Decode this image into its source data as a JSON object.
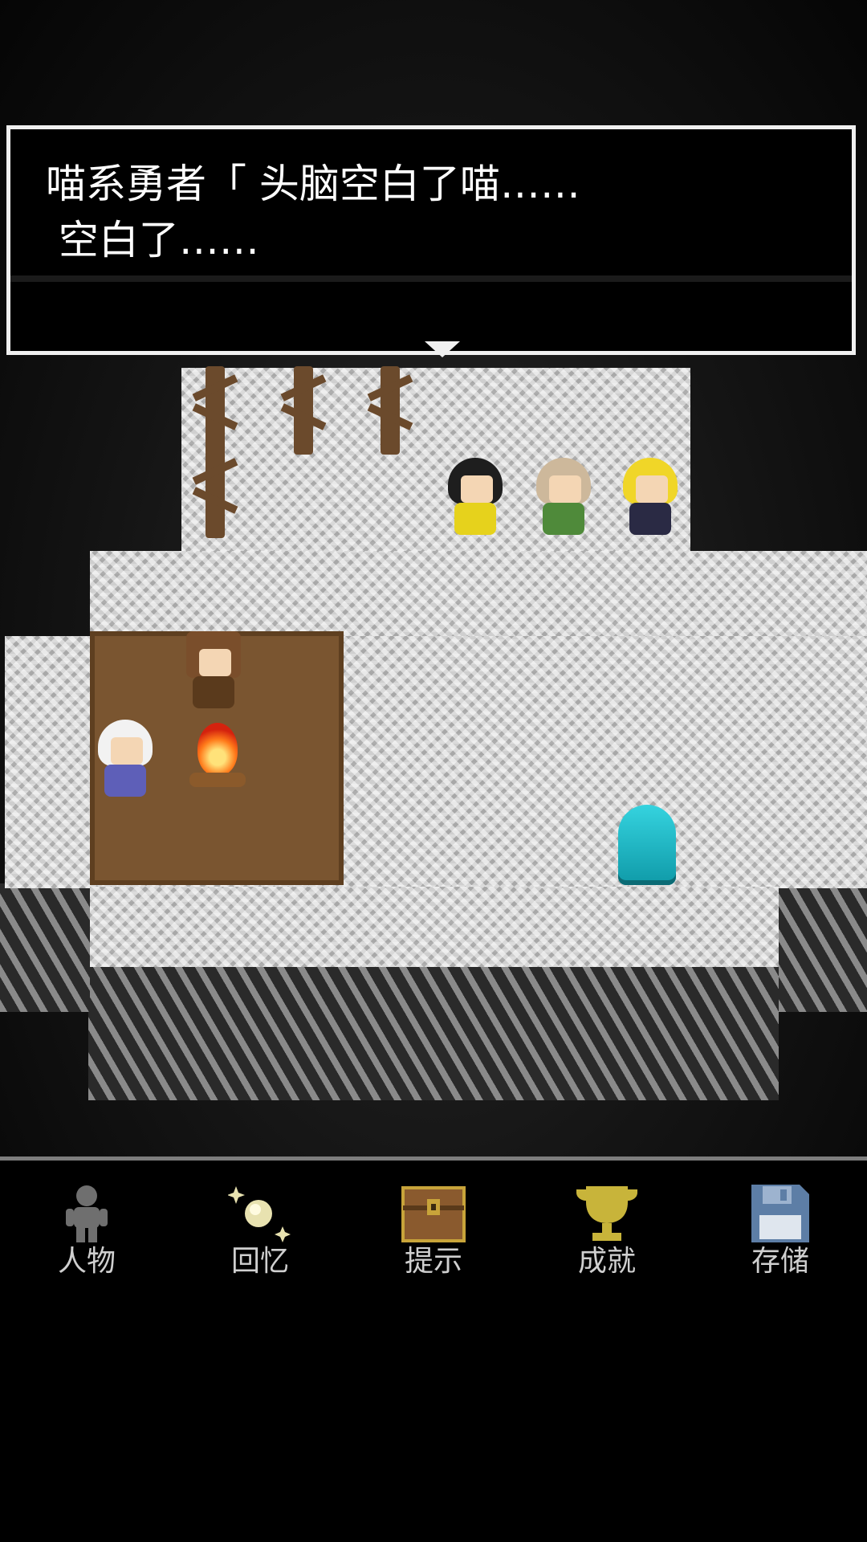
{
  "dialog": {
    "line1": "喵系勇者「 头脑空白了喵……",
    "line2": " 空白了……"
  },
  "menu": {
    "items": [
      {
        "label": "人物",
        "icon": "person-icon"
      },
      {
        "label": "回忆",
        "icon": "sparkle-memory-icon"
      },
      {
        "label": "提示",
        "icon": "treasure-chest-icon"
      },
      {
        "label": "成就",
        "icon": "trophy-icon"
      },
      {
        "label": "存储",
        "icon": "floppy-disk-icon"
      }
    ]
  },
  "colors": {
    "dialog_border": "#f0f0f0",
    "menu_text": "#cfcfcf",
    "menu_border": "#7d7d7d",
    "trophy": "#c8b43a",
    "chest": "#8a5a2e",
    "floppy": "#5d7ea6",
    "crystal": "#22c4d2"
  }
}
